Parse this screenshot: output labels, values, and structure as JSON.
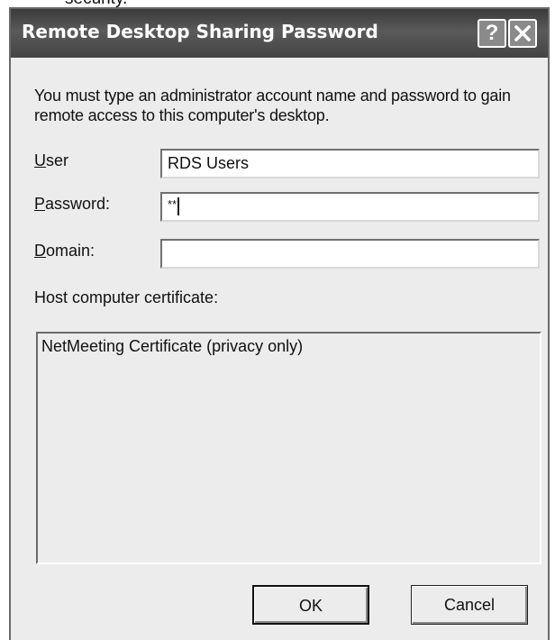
{
  "page_fragment": "security.",
  "window": {
    "title": "Remote Desktop Sharing Password",
    "help_label": "?",
    "close_icon": "close-icon"
  },
  "intro_text": "You must type an administrator account name and password to gain remote access to this computer's desktop.",
  "fields": {
    "user": {
      "label_mnemonic": "U",
      "label_rest": "ser",
      "value": "RDS Users"
    },
    "password": {
      "label_mnemonic": "P",
      "label_rest": "assword:",
      "value": "**"
    },
    "domain": {
      "label_mnemonic": "D",
      "label_rest": "omain:",
      "value": ""
    }
  },
  "certificate": {
    "label": "Host computer certificate:",
    "items": [
      "NetMeeting Certificate (privacy only)"
    ]
  },
  "buttons": {
    "ok": "OK",
    "cancel": "Cancel"
  }
}
